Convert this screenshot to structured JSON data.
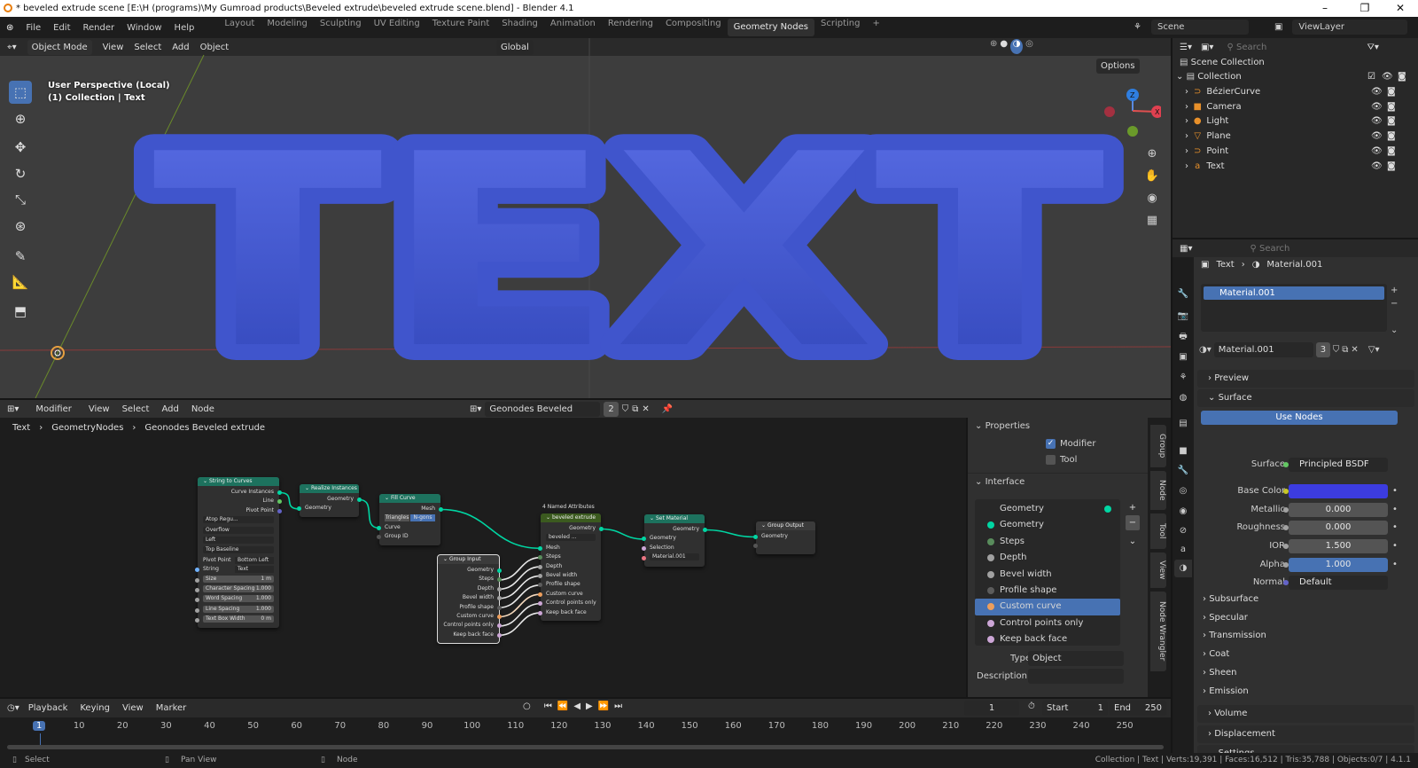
{
  "title_bar": {
    "title": "* beveled extrude scene [E:\\H (programs)\\My Gumroad products\\Beveled extrude\\beveled extrude scene.blend] - Blender 4.1",
    "minimize": "–",
    "maximize": "❐",
    "close": "✕"
  },
  "menu": [
    "File",
    "Edit",
    "Render",
    "Window",
    "Help"
  ],
  "workspaces": [
    "Layout",
    "Modeling",
    "Sculpting",
    "UV Editing",
    "Texture Paint",
    "Shading",
    "Animation",
    "Rendering",
    "Compositing",
    "Geometry Nodes",
    "Scripting",
    "+"
  ],
  "active_workspace": "Geometry Nodes",
  "scene": "Scene",
  "view_layer": "ViewLayer",
  "viewport": {
    "mode": "Object Mode",
    "menus": [
      "View",
      "Select",
      "Add",
      "Object"
    ],
    "orientation": "Global",
    "options": "Options",
    "overlay_line1": "User Perspective (Local)",
    "overlay_line2": "(1) Collection | Text",
    "text3d": "TEXT",
    "axes": {
      "z": "Z",
      "x": "X"
    },
    "text_color": "#4a5fd6"
  },
  "outliner": {
    "search_placeholder": "Search",
    "scene_collection": "Scene Collection",
    "collection": "Collection",
    "items": [
      {
        "name": "BézierCurve",
        "icon": "curve-icon",
        "glyph": "⊃"
      },
      {
        "name": "Camera",
        "icon": "camera-icon",
        "glyph": "■"
      },
      {
        "name": "Light",
        "icon": "light-icon",
        "glyph": "●"
      },
      {
        "name": "Plane",
        "icon": "mesh-icon",
        "glyph": "▽"
      },
      {
        "name": "Point",
        "icon": "curve-icon",
        "glyph": "⊃"
      },
      {
        "name": "Text",
        "icon": "text-icon",
        "glyph": "a"
      }
    ]
  },
  "node_editor": {
    "type": "Modifier",
    "menus": [
      "View",
      "Select",
      "Add",
      "Node"
    ],
    "tree_name": "Geonodes Beveled extrude",
    "users": "2",
    "breadcrumb": [
      "Text",
      "GeometryNodes",
      "Geonodes Beveled extrude"
    ],
    "nodes": {
      "s2c": {
        "title": "String to Curves",
        "color": "#1d725e",
        "rows": [
          {
            "t": "out",
            "label": "Curve Instances",
            "c": "#00d6a3"
          },
          {
            "t": "out",
            "label": "Line",
            "c": "#63c763"
          },
          {
            "t": "out",
            "label": "Pivot Point",
            "c": "#6363c7"
          },
          {
            "t": "dd",
            "label": "Atop Regu..."
          },
          {
            "t": "dd",
            "label": "Overflow"
          },
          {
            "t": "dd",
            "label": "Left"
          },
          {
            "t": "dd",
            "label": "Top Baseline"
          },
          {
            "t": "kv",
            "label": "Pivot Point",
            "value": "Bottom Left"
          },
          {
            "t": "kv",
            "label": "String",
            "value": "Text",
            "c": "#70b2ff"
          },
          {
            "t": "nf",
            "label": "Size",
            "value": "1 m",
            "c": "#a1a1a1"
          },
          {
            "t": "nf",
            "label": "Character Spacing",
            "value": "1.000",
            "c": "#a1a1a1"
          },
          {
            "t": "nf",
            "label": "Word Spacing",
            "value": "1.000",
            "c": "#a1a1a1"
          },
          {
            "t": "nf",
            "label": "Line Spacing",
            "value": "1.000",
            "c": "#a1a1a1"
          },
          {
            "t": "nf",
            "label": "Text Box Width",
            "value": "0 m",
            "c": "#a1a1a1"
          }
        ]
      },
      "realize": {
        "title": "Realize Instances",
        "color": "#1d725e",
        "rows": [
          {
            "t": "out",
            "label": "Geometry",
            "c": "#00d6a3"
          },
          {
            "t": "in",
            "label": "Geometry",
            "c": "#00d6a3"
          }
        ]
      },
      "fill": {
        "title": "Fill Curve",
        "color": "#1d725e",
        "rows": [
          {
            "t": "out",
            "label": "Mesh",
            "c": "#00d6a3"
          },
          {
            "t": "seg",
            "label": "Triangles",
            "value": "N-gons"
          },
          {
            "t": "in",
            "label": "Curve",
            "c": "#00d6a3"
          },
          {
            "t": "in",
            "label": "Group ID",
            "c": "#555555"
          }
        ]
      },
      "ginput": {
        "title": "Group Input",
        "color": "#3b3b3b",
        "rows": [
          {
            "t": "out",
            "label": "Geometry",
            "c": "#00d6a3"
          },
          {
            "t": "out",
            "label": "Steps",
            "c": "#598c5c"
          },
          {
            "t": "out",
            "label": "Depth",
            "c": "#a1a1a1"
          },
          {
            "t": "out",
            "label": "Bevel width",
            "c": "#a1a1a1"
          },
          {
            "t": "out",
            "label": "Profile shape",
            "c": "#5c5c5c"
          },
          {
            "t": "out",
            "label": "Custom curve",
            "c": "#ed9e5c"
          },
          {
            "t": "out",
            "label": "Control points only",
            "c": "#cca6d6"
          },
          {
            "t": "out",
            "label": "Keep back face",
            "c": "#cca6d6"
          }
        ]
      },
      "bevel": {
        "badge": "4 Named Attributes",
        "title": "beveled extrude",
        "color": "#3b5a1f",
        "rows": [
          {
            "t": "out",
            "label": "Geometry",
            "c": "#00d6a3"
          },
          {
            "t": "dd",
            "label": "beveled ..."
          },
          {
            "t": "in",
            "label": "Mesh",
            "c": "#00d6a3"
          },
          {
            "t": "in",
            "label": "Steps",
            "c": "#598c5c"
          },
          {
            "t": "in",
            "label": "Depth",
            "c": "#a1a1a1"
          },
          {
            "t": "in",
            "label": "Bevel width",
            "c": "#a1a1a1"
          },
          {
            "t": "in",
            "label": "Profile shape",
            "c": "#5c5c5c"
          },
          {
            "t": "in",
            "label": "Custom curve",
            "c": "#ed9e5c"
          },
          {
            "t": "in",
            "label": "Control points only",
            "c": "#cca6d6"
          },
          {
            "t": "in",
            "label": "Keep back face",
            "c": "#cca6d6"
          }
        ]
      },
      "setmat": {
        "title": "Set Material",
        "color": "#1d725e",
        "rows": [
          {
            "t": "out",
            "label": "Geometry",
            "c": "#00d6a3"
          },
          {
            "t": "in",
            "label": "Geometry",
            "c": "#00d6a3"
          },
          {
            "t": "in",
            "label": "Selection",
            "c": "#cca6d6"
          },
          {
            "t": "dd",
            "label": "Material.001",
            "c": "#eb7582"
          }
        ]
      },
      "gout": {
        "title": "Group Output",
        "color": "#3b3b3b",
        "rows": [
          {
            "t": "in",
            "label": "Geometry",
            "c": "#00d6a3"
          },
          {
            "t": "in",
            "label": "",
            "c": "#555555"
          }
        ]
      }
    },
    "links": [
      [
        "s2c",
        0,
        "realize",
        1,
        "#00d6a3"
      ],
      [
        "realize",
        0,
        "fill",
        2,
        "#00d6a3"
      ],
      [
        "fill",
        0,
        "bevel",
        2,
        "#00d6a3"
      ],
      [
        "ginput",
        1,
        "bevel",
        3,
        "#e8e8e8"
      ],
      [
        "ginput",
        2,
        "bevel",
        4,
        "#e8e8e8"
      ],
      [
        "ginput",
        3,
        "bevel",
        5,
        "#e8e8e8"
      ],
      [
        "ginput",
        4,
        "bevel",
        6,
        "#e8e8e8"
      ],
      [
        "ginput",
        5,
        "bevel",
        7,
        "#f5d9bd"
      ],
      [
        "ginput",
        6,
        "bevel",
        8,
        "#e8e8e8"
      ],
      [
        "ginput",
        7,
        "bevel",
        9,
        "#e8e8e8"
      ],
      [
        "bevel",
        0,
        "setmat",
        1,
        "#00d6a3"
      ],
      [
        "setmat",
        0,
        "gout",
        0,
        "#00d6a3"
      ]
    ]
  },
  "sidebar": {
    "tabs": [
      "Group",
      "Node",
      "Tool",
      "View",
      "Node Wrangler"
    ],
    "properties_title": "Properties",
    "modifier": "Modifier",
    "tool": "Tool",
    "interface_title": "Interface",
    "interface_items": [
      {
        "label": "Geometry",
        "c": "#00d6a3",
        "output": true
      },
      {
        "label": "Geometry",
        "c": "#00d6a3"
      },
      {
        "label": "Steps",
        "c": "#598c5c"
      },
      {
        "label": "Depth",
        "c": "#a1a1a1"
      },
      {
        "label": "Bevel width",
        "c": "#a1a1a1"
      },
      {
        "label": "Profile shape",
        "c": "#5c5c5c"
      },
      {
        "label": "Custom curve",
        "c": "#ed9e5c",
        "selected": true
      },
      {
        "label": "Control points only",
        "c": "#cca6d6"
      },
      {
        "label": "Keep back face",
        "c": "#cca6d6"
      }
    ],
    "type_label": "Type",
    "type_value": "Object",
    "description_label": "Description"
  },
  "timeline": {
    "menus": [
      "Playback",
      "Keying",
      "View",
      "Marker"
    ],
    "current_frame": "1",
    "start_label": "Start",
    "start": "1",
    "end_label": "End",
    "end": "250",
    "ticks": [
      "1",
      "10",
      "20",
      "30",
      "40",
      "50",
      "60",
      "70",
      "80",
      "90",
      "100",
      "110",
      "120",
      "130",
      "140",
      "150",
      "160",
      "170",
      "180",
      "190",
      "200",
      "210",
      "220",
      "230",
      "240",
      "250"
    ]
  },
  "properties": {
    "search_placeholder": "Search",
    "breadcrumb": [
      "Text",
      "Material.001"
    ],
    "slot": "Material.001",
    "material": "Material.001",
    "users": "3",
    "panels": {
      "preview": "Preview",
      "surface": "Surface"
    },
    "use_nodes": "Use Nodes",
    "fields": [
      {
        "label": "Surface",
        "value": "Principled BSDF",
        "c": "#63c763"
      },
      {
        "label": "Base Color",
        "value": "",
        "c": "#c7c729",
        "swatch": "#3c3ce0"
      },
      {
        "label": "Metallic",
        "value": "0.000",
        "c": "#a1a1a1"
      },
      {
        "label": "Roughness",
        "value": "0.000",
        "c": "#a1a1a1"
      },
      {
        "label": "IOR",
        "value": "1.500",
        "c": "#a1a1a1"
      },
      {
        "label": "Alpha",
        "value": "1.000",
        "c": "#a1a1a1",
        "fill": 1.0
      },
      {
        "label": "Normal",
        "value": "Default",
        "c": "#6363c7"
      }
    ],
    "subpanels": [
      "Subsurface",
      "Specular",
      "Transmission",
      "Coat",
      "Sheen",
      "Emission"
    ],
    "bottom_panels": [
      "Volume",
      "Displacement",
      "Settings"
    ]
  },
  "status": {
    "select": "Select",
    "pan": "Pan View",
    "node": "Node",
    "stats": "Collection | Text | Verts:19,391 | Faces:16,512 | Tris:35,788 | Objects:0/7 | 4.1.1"
  }
}
